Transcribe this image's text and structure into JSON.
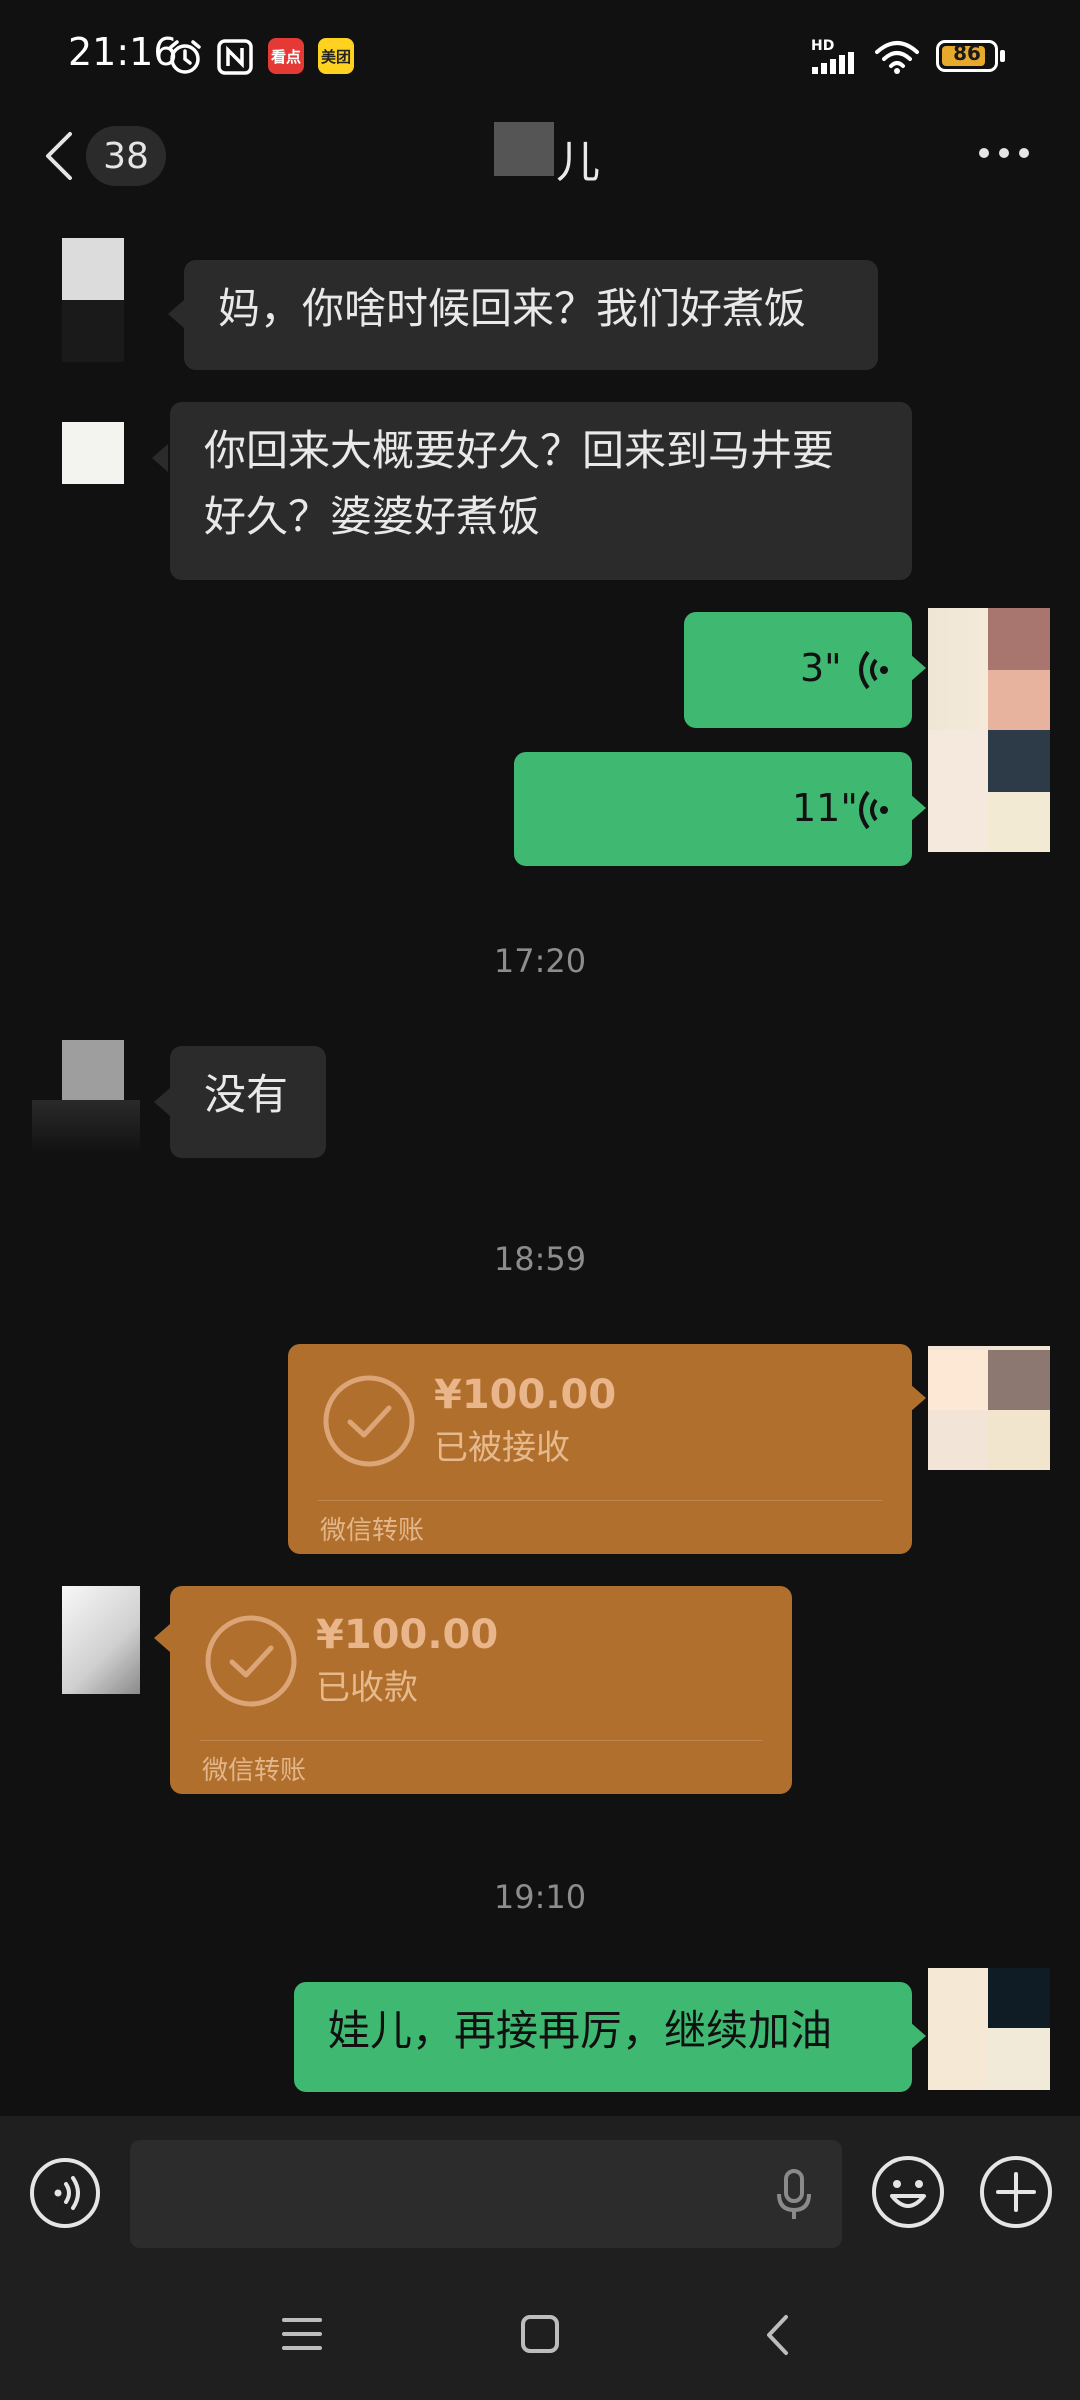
{
  "status_bar": {
    "time": "21:16",
    "icons": [
      "alarm-icon",
      "nfc-icon",
      "toutiao-app-icon",
      "meituan-app-icon"
    ],
    "app_badge_1": "看点",
    "app_badge_2": "美团",
    "network": "HD",
    "battery": "86"
  },
  "header": {
    "unread_count": "38",
    "title_visible": "儿"
  },
  "messages": {
    "m1": "妈，你啥时候回来？我们好煮饭",
    "m2_line1": "你回来大概要好久？回来到马井要",
    "m2_line2": "好久？婆婆好煮饭",
    "voice1": "3\"",
    "voice2": "11\"",
    "time1": "17:20",
    "m3": "没有",
    "time2": "18:59",
    "transfer_out_amount": "¥100.00",
    "transfer_out_status": "已被接收",
    "transfer_out_label": "微信转账",
    "transfer_in_amount": "¥100.00",
    "transfer_in_status": "已收款",
    "transfer_in_label": "微信转账",
    "time3": "19:10",
    "m4": "娃儿，再接再厉，继续加油"
  },
  "colors": {
    "background": "#111111",
    "incoming_bubble": "#2b2b2b",
    "outgoing_bubble": "#3fb872",
    "transfer_card": "#b06f2c"
  }
}
